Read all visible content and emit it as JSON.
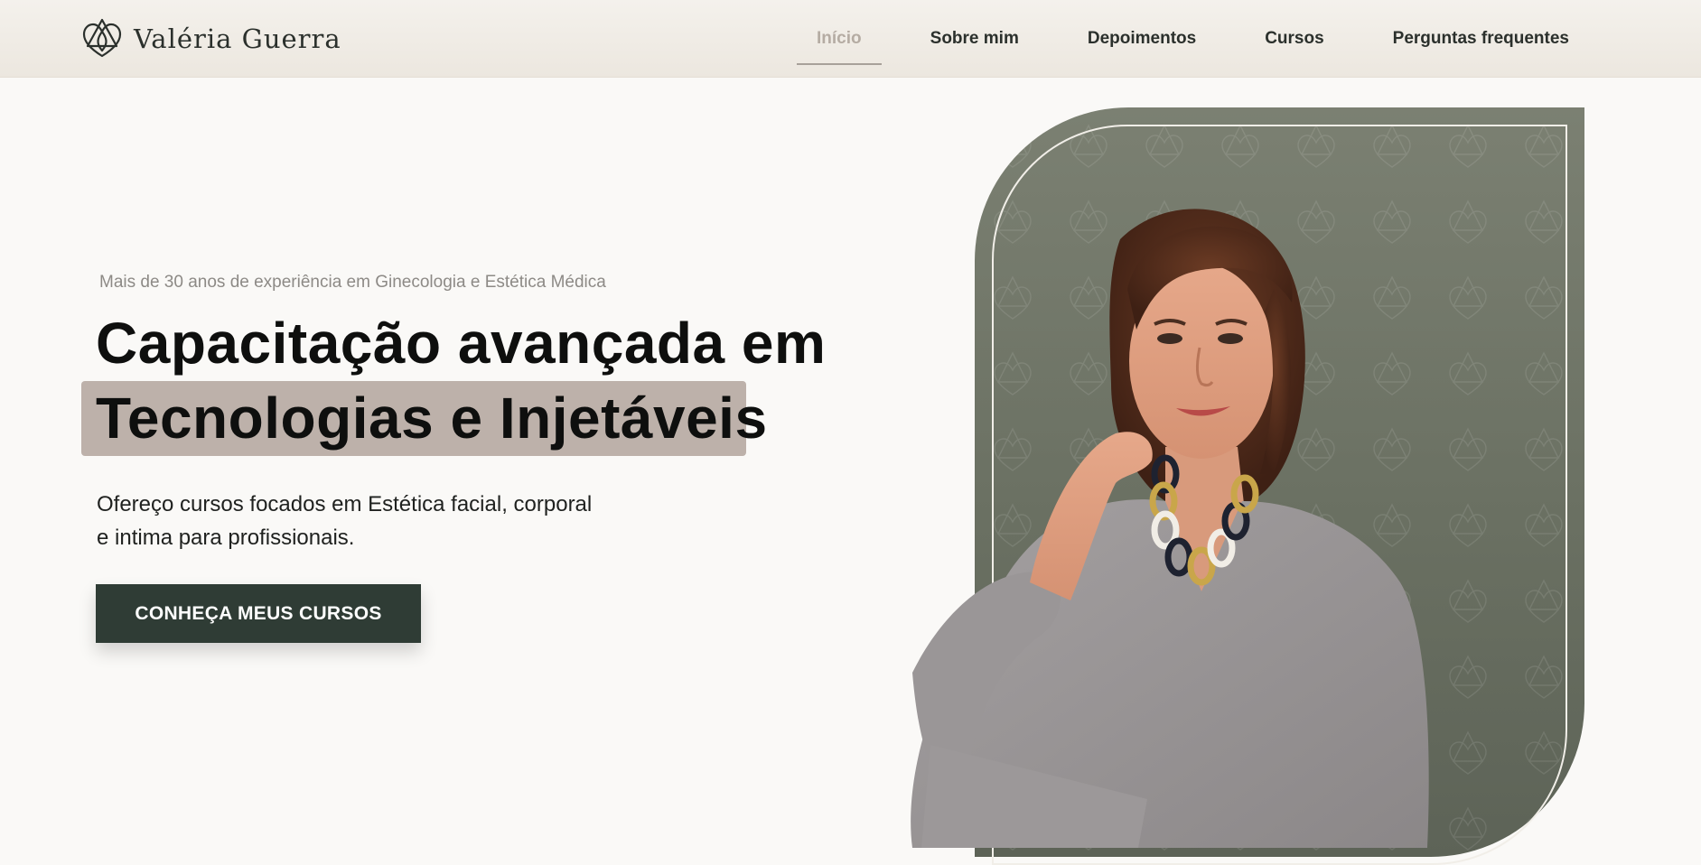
{
  "header": {
    "brand": "Valéria Guerra",
    "logo_icon": "heart-knot-icon",
    "nav": [
      {
        "label": "Início",
        "active": true
      },
      {
        "label": "Sobre mim",
        "active": false
      },
      {
        "label": "Depoimentos",
        "active": false
      },
      {
        "label": "Cursos",
        "active": false
      },
      {
        "label": "Perguntas frequentes",
        "active": false
      }
    ]
  },
  "hero": {
    "subtitle": "Mais de 30 anos de experiência em Ginecologia e Estética Médica",
    "headline_line1": "Capacitação avançada em",
    "headline_line2": "Tecnologias e Injetáveis",
    "description_line1": "Ofereço cursos focados em Estética facial, corporal",
    "description_line2": "e intima para profissionais.",
    "cta_label": "CONHEÇA MEUS CURSOS"
  },
  "colors": {
    "background": "#faf9f7",
    "header_bg": "#f1ede7",
    "accent_green": "#2f3c35",
    "frame_green": "#6e7367",
    "highlight": "#bdb1aa",
    "nav_active": "#b5aca3"
  }
}
